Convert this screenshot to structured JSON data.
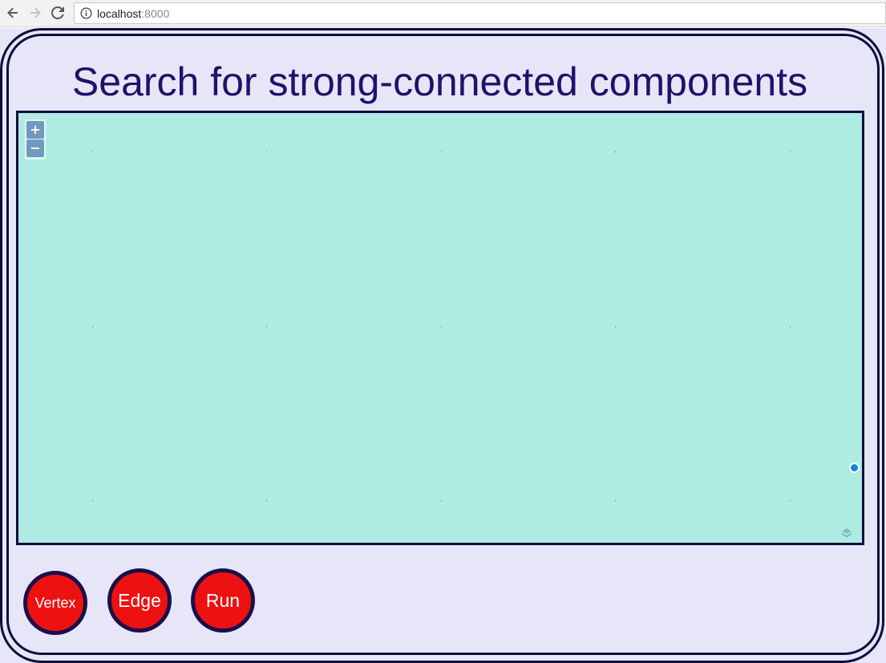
{
  "browser": {
    "url_host": "localhost",
    "url_port": ":8000",
    "icons": [
      "back-arrow-icon",
      "forward-arrow-icon",
      "reload-icon",
      "info-icon"
    ]
  },
  "page": {
    "title": "Search for strong-connected components",
    "colors": {
      "background": "#e6e6f8",
      "frame": "#0f0c3d",
      "title": "#1e126a",
      "map": "#aeebe3",
      "button": "#ed1111",
      "location_dot": "#0a86e4"
    }
  },
  "map": {
    "zoom_in_label": "+",
    "zoom_out_label": "−",
    "icons": [
      "location-dot-icon",
      "layers-icon"
    ]
  },
  "controls": {
    "vertex_label": "Vertex",
    "edge_label": "Edge",
    "run_label": "Run"
  }
}
